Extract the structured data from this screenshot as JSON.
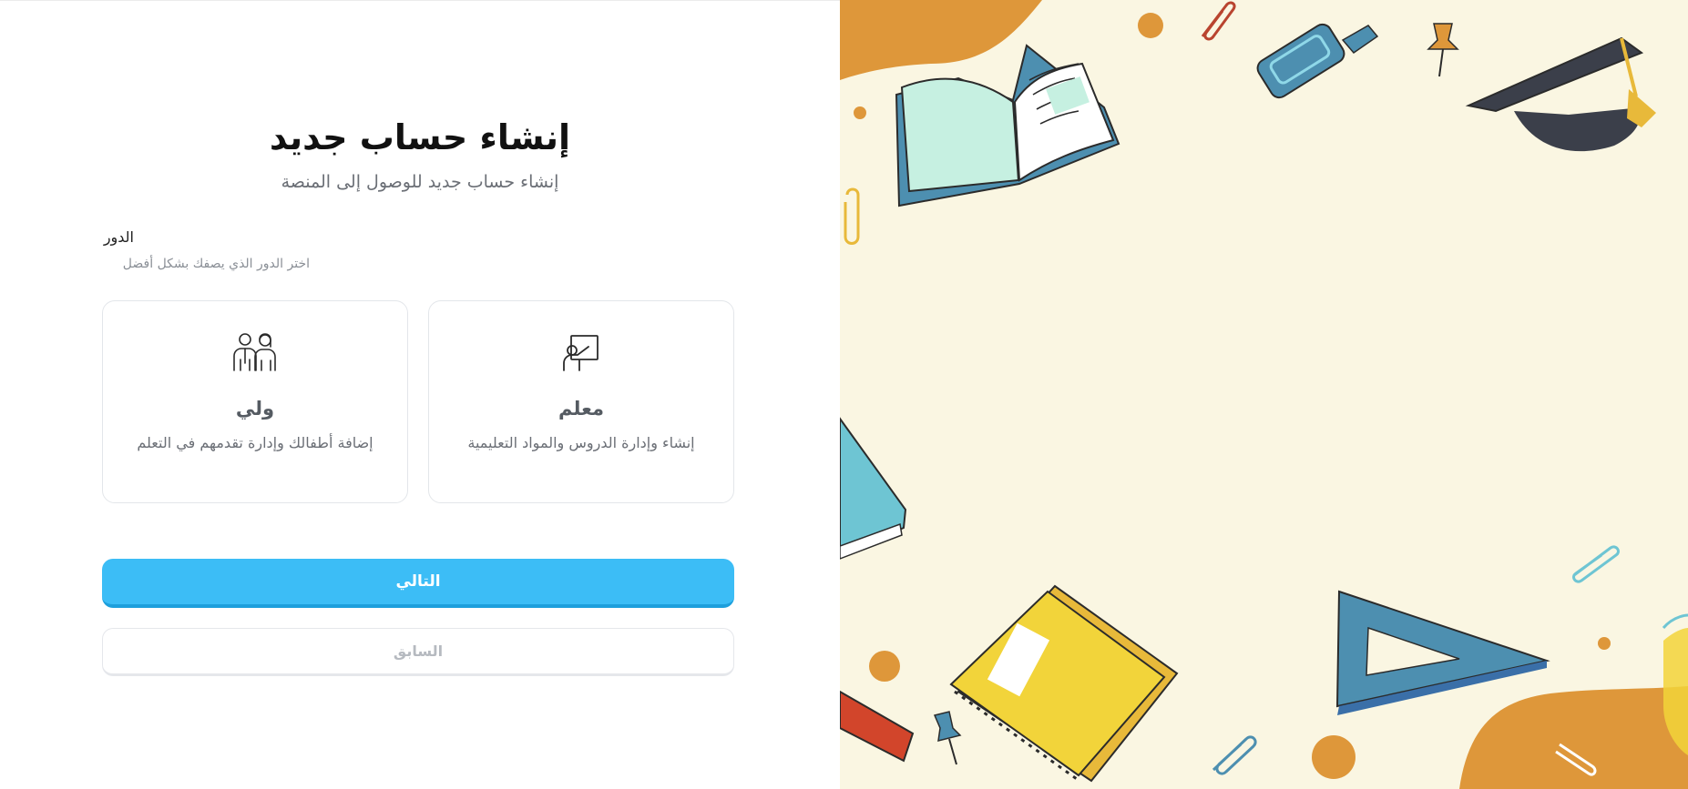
{
  "form": {
    "title": "إنشاء حساب جديد",
    "subtitle": "إنشاء حساب جديد للوصول إلى المنصة",
    "role_label": "الدور",
    "role_hint": "اختر الدور الذي يصفك بشكل أفضل"
  },
  "roles": [
    {
      "title": "معلم",
      "description": "إنشاء وإدارة الدروس والمواد التعليمية",
      "icon": "teacher-board-icon"
    },
    {
      "title": "ولي",
      "description": "إضافة أطفالك وإدارة تقدمهم في التعلم",
      "icon": "parents-icon"
    }
  ],
  "buttons": {
    "next_label": "التالي",
    "prev_label": "السابق"
  },
  "colors": {
    "primary": "#3cbdf6",
    "illustration_bg": "#faf6e2",
    "accent_orange": "#de973a"
  }
}
